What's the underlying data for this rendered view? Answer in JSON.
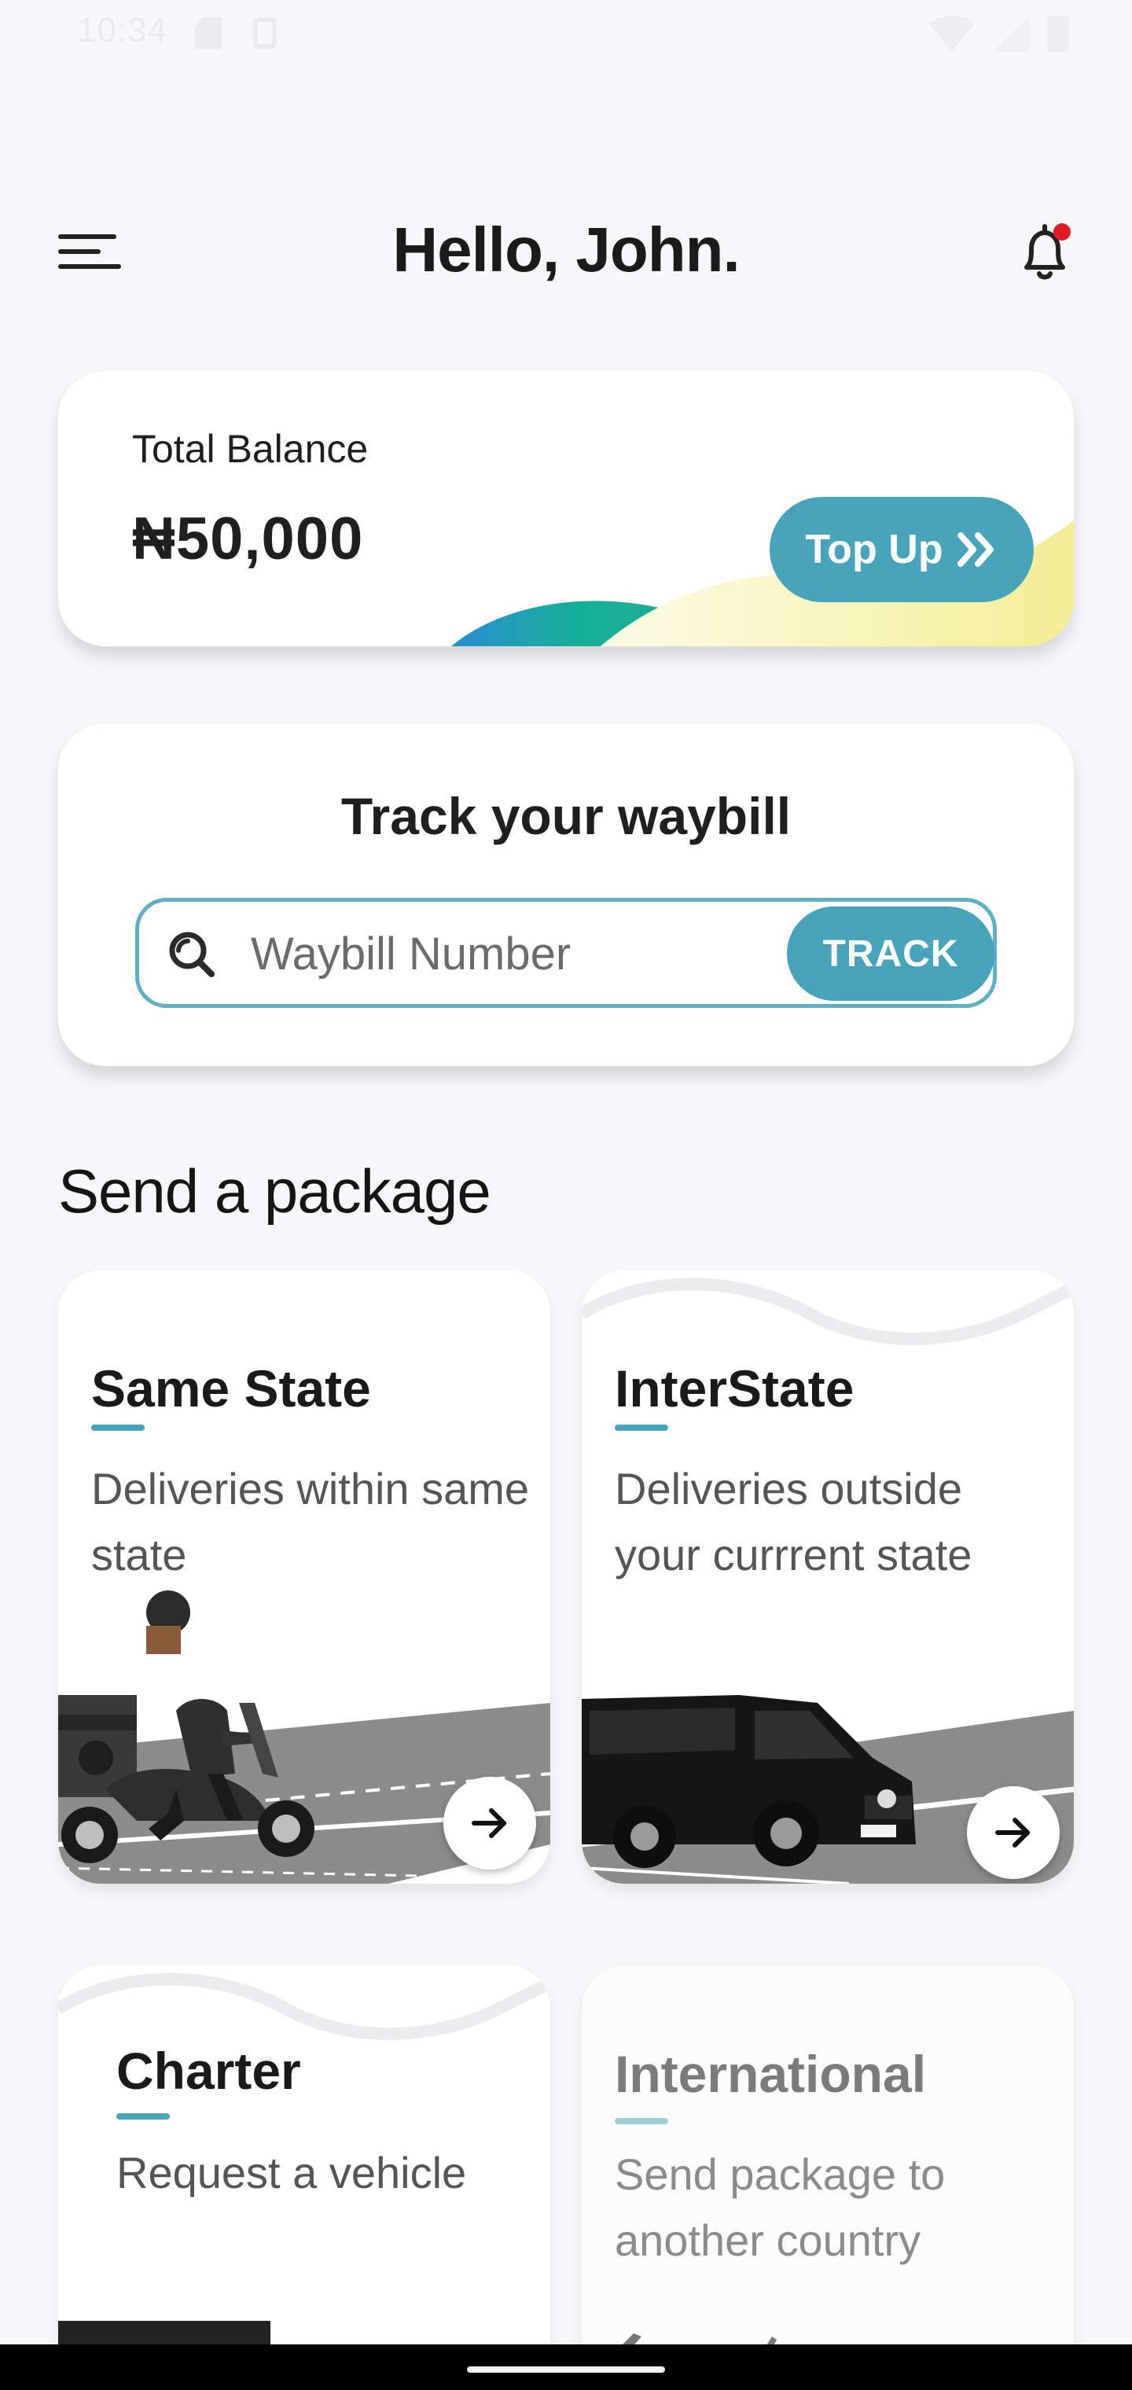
{
  "status_bar": {
    "time": "10:34",
    "icons": [
      "sd-card-icon",
      "sim-icon",
      "wifi-icon",
      "signal-icon",
      "battery-icon"
    ]
  },
  "header": {
    "greeting": "Hello, John.",
    "menu_icon": "hamburger-menu-icon",
    "notification_icon": "bell-icon",
    "has_unread_notifications": true
  },
  "balance": {
    "label": "Total Balance",
    "amount": "₦50,000",
    "top_up_label": "Top Up",
    "top_up_icon": "double-chevron-right-icon"
  },
  "track": {
    "title": "Track your waybill",
    "input_value": "",
    "placeholder": "Waybill Number",
    "button_label": "TRACK",
    "search_icon": "search-icon"
  },
  "send_package": {
    "title": "Send a package",
    "options": [
      {
        "title": "Same State",
        "description": "Deliveries within same state",
        "illustration": "scooter-rider",
        "enabled": true
      },
      {
        "title": "InterState",
        "description": "Deliveries outside your currrent state",
        "illustration": "delivery-van",
        "enabled": true
      },
      {
        "title": "Charter",
        "description": "Request a vehicle",
        "illustration": "vehicle",
        "enabled": true
      },
      {
        "title": "International",
        "description": "Send package to another country",
        "illustration": "airplane",
        "enabled": false
      }
    ]
  },
  "colors": {
    "accent": "#47a4ba",
    "background": "#f7f7f9",
    "card": "#ffffff",
    "notification_dot": "#e01b24",
    "wave_yellow": "#f3f1a8",
    "wave_green": "#1fae8f"
  }
}
